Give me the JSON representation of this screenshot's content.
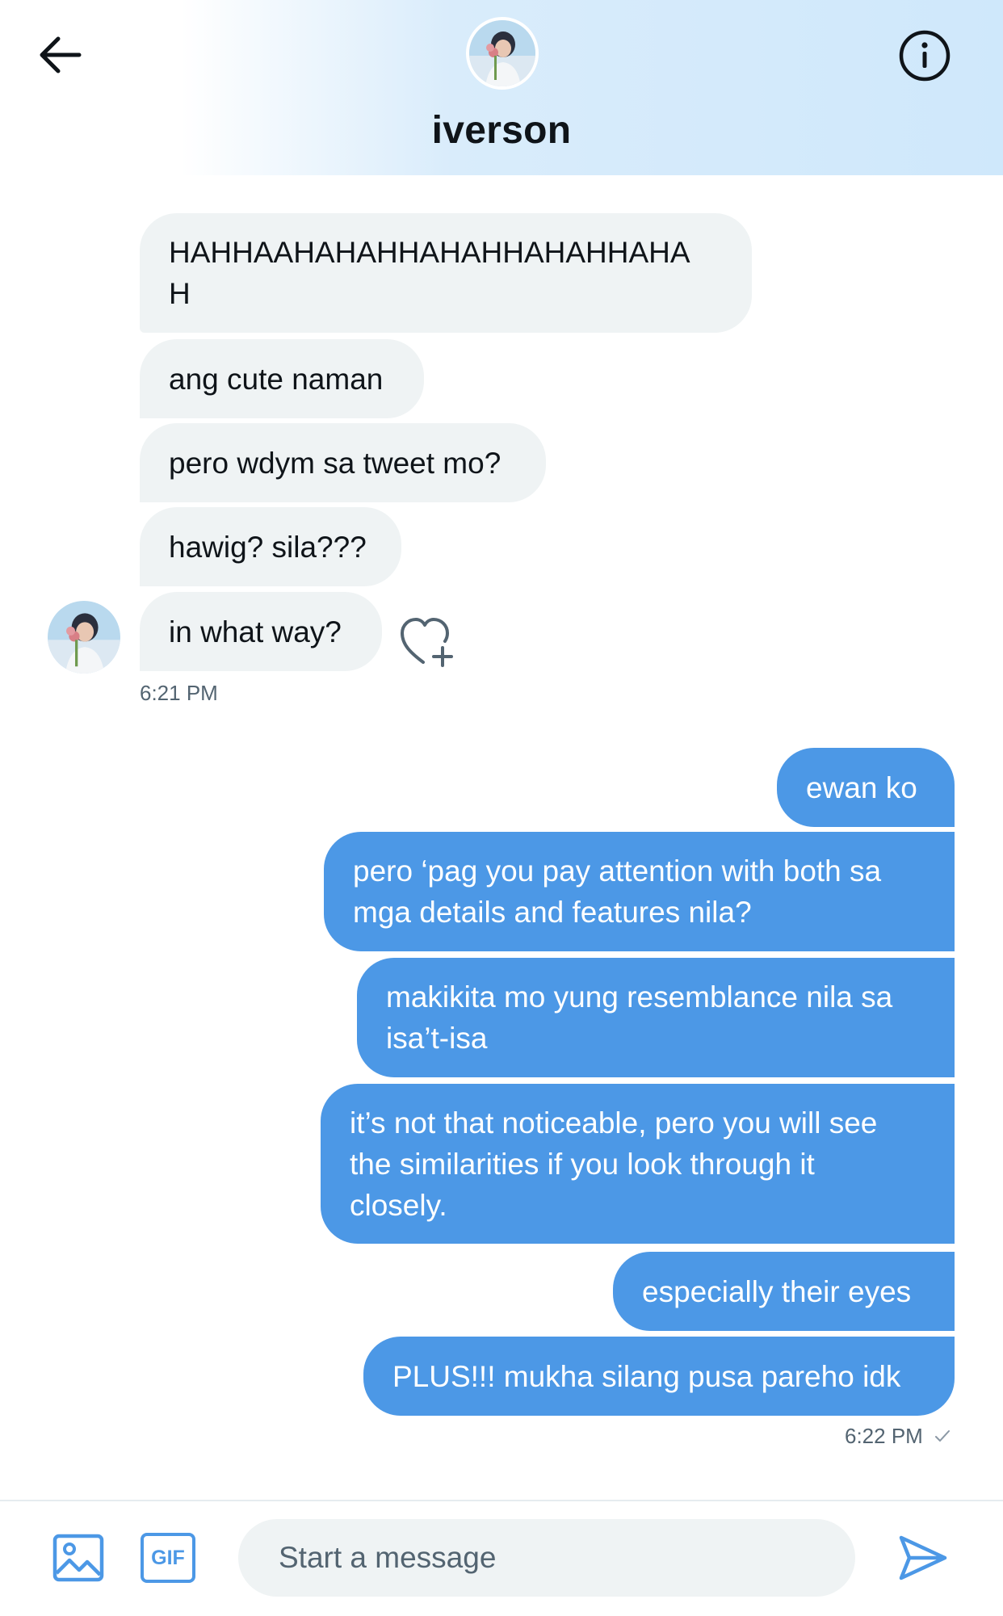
{
  "header": {
    "name": "iverson",
    "back_icon": "arrow-left-icon",
    "info_icon": "info-icon"
  },
  "incoming": [
    {
      "text": "HAHHAAHAHAHHAHAHHAHAHHAHA\nH"
    },
    {
      "text": "ang cute naman"
    },
    {
      "text": "pero wdym sa tweet mo?"
    },
    {
      "text": "hawig? sila???"
    },
    {
      "text": "in what way?"
    }
  ],
  "incoming_time": "6:21 PM",
  "outgoing": [
    {
      "text": "ewan ko"
    },
    {
      "text": "pero ‘pag you pay attention with both sa\nmga details and features nila?"
    },
    {
      "text": "makikita mo yung resemblance nila sa\nisa’t-isa"
    },
    {
      "text": "it’s not that noticeable, pero you will see\nthe similarities if you look through it\nclosely."
    },
    {
      "text": "especially their eyes"
    },
    {
      "text": "PLUS!!! mukha silang pusa pareho idk"
    }
  ],
  "outgoing_time": "6:22 PM",
  "outgoing_status_icon": "check-icon",
  "composer": {
    "placeholder": "Start a message",
    "gif_label": "GIF",
    "media_icon": "image-icon",
    "send_icon": "send-icon"
  },
  "colors": {
    "outgoing_bubble": "#4c98e6",
    "incoming_bubble": "#eff3f4",
    "accent": "#4c98e6"
  }
}
